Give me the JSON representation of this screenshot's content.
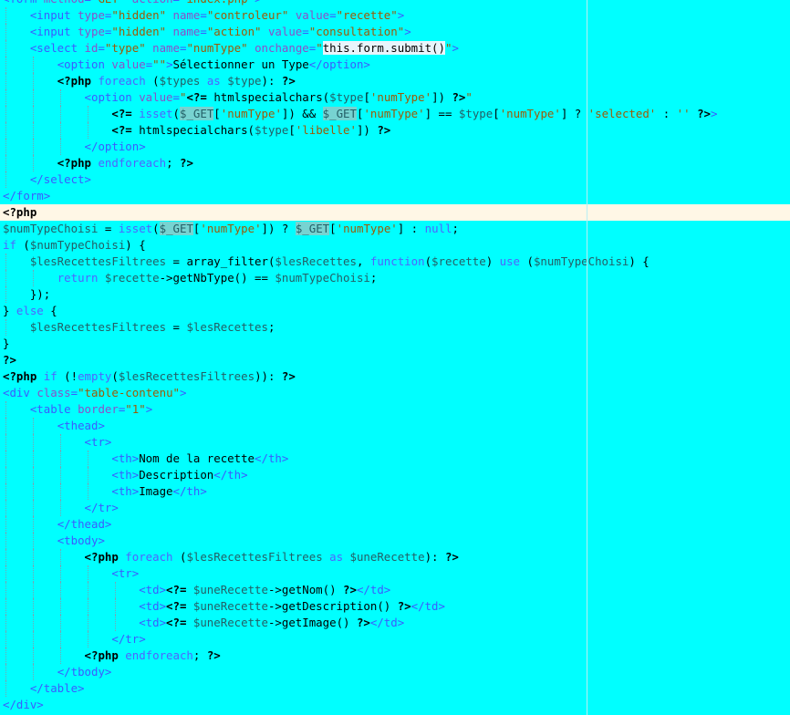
{
  "colors": {
    "background": "#00ffff",
    "current_line": "#fff7e6",
    "html_tag": "#3b5bff",
    "attribute": "#8a50c8",
    "string": "#9d5a05",
    "keyword": "#4f63ff",
    "variable": "#245f66"
  },
  "editor": {
    "lines": [
      {
        "indent": 0,
        "tokens": [
          [
            "tag",
            "<form "
          ],
          [
            "attr",
            "method"
          ],
          [
            "tag",
            "="
          ],
          [
            "str",
            "\"GET\" "
          ],
          [
            "attr",
            "action"
          ],
          [
            "tag",
            "="
          ],
          [
            "str",
            "\"index.php\""
          ],
          [
            "tag",
            ">"
          ]
        ]
      },
      {
        "indent": 1,
        "tokens": [
          [
            "tag",
            "<input "
          ],
          [
            "attr",
            "type"
          ],
          [
            "tag",
            "="
          ],
          [
            "str",
            "\"hidden\" "
          ],
          [
            "attr",
            "name"
          ],
          [
            "tag",
            "="
          ],
          [
            "str",
            "\"controleur\" "
          ],
          [
            "attr",
            "value"
          ],
          [
            "tag",
            "="
          ],
          [
            "str",
            "\"recette\""
          ],
          [
            "tag",
            ">"
          ]
        ]
      },
      {
        "indent": 1,
        "tokens": [
          [
            "tag",
            "<input "
          ],
          [
            "attr",
            "type"
          ],
          [
            "tag",
            "="
          ],
          [
            "str",
            "\"hidden\" "
          ],
          [
            "attr",
            "name"
          ],
          [
            "tag",
            "="
          ],
          [
            "str",
            "\"action\" "
          ],
          [
            "attr",
            "value"
          ],
          [
            "tag",
            "="
          ],
          [
            "str",
            "\"consultation\""
          ],
          [
            "tag",
            ">"
          ]
        ]
      },
      {
        "indent": 1,
        "tokens": [
          [
            "tag",
            "<select "
          ],
          [
            "attr",
            "id"
          ],
          [
            "tag",
            "="
          ],
          [
            "str",
            "\"type\" "
          ],
          [
            "attr",
            "name"
          ],
          [
            "tag",
            "="
          ],
          [
            "str",
            "\"numType\" "
          ],
          [
            "attr",
            "onchange"
          ],
          [
            "tag",
            "="
          ],
          [
            "str",
            "\""
          ],
          [
            "hl",
            "this.form.submit()"
          ],
          [
            "str",
            "\""
          ],
          [
            "tag",
            ">"
          ]
        ]
      },
      {
        "indent": 2,
        "tokens": [
          [
            "tag",
            "<option "
          ],
          [
            "attr",
            "value"
          ],
          [
            "tag",
            "="
          ],
          [
            "str",
            "\"\""
          ],
          [
            "tag",
            ">"
          ],
          [
            "txt",
            "Sélectionner un Type"
          ],
          [
            "tag",
            "</option>"
          ]
        ]
      },
      {
        "indent": 2,
        "tokens": [
          [
            "php",
            "<?php "
          ],
          [
            "kw",
            "foreach "
          ],
          [
            "op",
            "("
          ],
          [
            "var",
            "$types "
          ],
          [
            "kw",
            "as "
          ],
          [
            "var",
            "$type"
          ],
          [
            "op",
            "): "
          ],
          [
            "php",
            "?>"
          ]
        ]
      },
      {
        "indent": 3,
        "tokens": [
          [
            "tag",
            "<option "
          ],
          [
            "attr",
            "value"
          ],
          [
            "tag",
            "="
          ],
          [
            "str",
            "\""
          ],
          [
            "php",
            "<?= "
          ],
          [
            "fn",
            "htmlspecialchars("
          ],
          [
            "var",
            "$type"
          ],
          [
            "op",
            "["
          ],
          [
            "str",
            "'numType'"
          ],
          [
            "op",
            "]) "
          ],
          [
            "php",
            "?>"
          ],
          [
            "str",
            "\""
          ]
        ]
      },
      {
        "indent": 4,
        "tokens": [
          [
            "php",
            "<?= "
          ],
          [
            "kw",
            "isset"
          ],
          [
            "op",
            "("
          ],
          [
            "get",
            "$_GET"
          ],
          [
            "op",
            "["
          ],
          [
            "str",
            "'numType'"
          ],
          [
            "op",
            "]) && "
          ],
          [
            "get",
            "$_GET"
          ],
          [
            "op",
            "["
          ],
          [
            "str",
            "'numType'"
          ],
          [
            "op",
            "] == "
          ],
          [
            "var",
            "$type"
          ],
          [
            "op",
            "["
          ],
          [
            "str",
            "'numType'"
          ],
          [
            "op",
            "] ? "
          ],
          [
            "str",
            "'selected'"
          ],
          [
            "op",
            " : "
          ],
          [
            "str",
            "''"
          ],
          [
            "op",
            " "
          ],
          [
            "php",
            "?>"
          ],
          [
            "tag",
            ">"
          ]
        ]
      },
      {
        "indent": 4,
        "tokens": [
          [
            "php",
            "<?= "
          ],
          [
            "fn",
            "htmlspecialchars("
          ],
          [
            "var",
            "$type"
          ],
          [
            "op",
            "["
          ],
          [
            "str",
            "'libelle'"
          ],
          [
            "op",
            "]) "
          ],
          [
            "php",
            "?>"
          ]
        ]
      },
      {
        "indent": 3,
        "tokens": [
          [
            "tag",
            "</option>"
          ]
        ]
      },
      {
        "indent": 2,
        "tokens": [
          [
            "php",
            "<?php "
          ],
          [
            "kw",
            "endforeach"
          ],
          [
            "op",
            "; "
          ],
          [
            "php",
            "?>"
          ]
        ]
      },
      {
        "indent": 1,
        "tokens": [
          [
            "tag",
            "</select>"
          ]
        ]
      },
      {
        "indent": 0,
        "tokens": [
          [
            "tag",
            "</form>"
          ]
        ]
      },
      {
        "indent": 0,
        "current": true,
        "tokens": [
          [
            "php",
            "<?php"
          ]
        ]
      },
      {
        "indent": 0,
        "tokens": [
          [
            "var",
            "$numTypeChoisi"
          ],
          [
            "op",
            " = "
          ],
          [
            "kw",
            "isset"
          ],
          [
            "op",
            "("
          ],
          [
            "get",
            "$_GET"
          ],
          [
            "op",
            "["
          ],
          [
            "str",
            "'numType'"
          ],
          [
            "op",
            "]) ? "
          ],
          [
            "get",
            "$_GET"
          ],
          [
            "op",
            "["
          ],
          [
            "str",
            "'numType'"
          ],
          [
            "op",
            "] : "
          ],
          [
            "kw",
            "null"
          ],
          [
            "op",
            ";"
          ]
        ]
      },
      {
        "indent": 0,
        "tokens": [
          [
            "kw",
            "if "
          ],
          [
            "op",
            "("
          ],
          [
            "var",
            "$numTypeChoisi"
          ],
          [
            "op",
            ") {"
          ]
        ]
      },
      {
        "indent": 1,
        "tokens": [
          [
            "var",
            "$lesRecettesFiltrees"
          ],
          [
            "op",
            " = "
          ],
          [
            "fn",
            "array_filter("
          ],
          [
            "var",
            "$lesRecettes"
          ],
          [
            "op",
            ", "
          ],
          [
            "kw",
            "function"
          ],
          [
            "op",
            "("
          ],
          [
            "var",
            "$recette"
          ],
          [
            "op",
            ") "
          ],
          [
            "kw",
            "use "
          ],
          [
            "op",
            "("
          ],
          [
            "var",
            "$numTypeChoisi"
          ],
          [
            "op",
            ") {"
          ]
        ]
      },
      {
        "indent": 2,
        "tokens": [
          [
            "kw",
            "return "
          ],
          [
            "var",
            "$recette"
          ],
          [
            "op",
            "->"
          ],
          [
            "fn",
            "getNbType"
          ],
          [
            "op",
            "() == "
          ],
          [
            "var",
            "$numTypeChoisi"
          ],
          [
            "op",
            ";"
          ]
        ]
      },
      {
        "indent": 1,
        "tokens": [
          [
            "op",
            "});"
          ]
        ]
      },
      {
        "indent": 0,
        "tokens": [
          [
            "op",
            "} "
          ],
          [
            "kw",
            "else "
          ],
          [
            "op",
            "{"
          ]
        ]
      },
      {
        "indent": 1,
        "tokens": [
          [
            "var",
            "$lesRecettesFiltrees"
          ],
          [
            "op",
            " = "
          ],
          [
            "var",
            "$lesRecettes"
          ],
          [
            "op",
            ";"
          ]
        ]
      },
      {
        "indent": 0,
        "tokens": [
          [
            "op",
            "}"
          ]
        ]
      },
      {
        "indent": 0,
        "tokens": [
          [
            "php",
            "?>"
          ]
        ]
      },
      {
        "indent": 0,
        "tokens": [
          [
            "php",
            "<?php "
          ],
          [
            "kw",
            "if "
          ],
          [
            "op",
            "(!"
          ],
          [
            "kw",
            "empty"
          ],
          [
            "op",
            "("
          ],
          [
            "var",
            "$lesRecettesFiltrees"
          ],
          [
            "op",
            ")): "
          ],
          [
            "php",
            "?>"
          ]
        ]
      },
      {
        "indent": 0,
        "tokens": [
          [
            "tag",
            "<div "
          ],
          [
            "attr",
            "class"
          ],
          [
            "tag",
            "="
          ],
          [
            "str",
            "\"table-contenu\""
          ],
          [
            "tag",
            ">"
          ]
        ]
      },
      {
        "indent": 1,
        "tokens": [
          [
            "tag",
            "<table "
          ],
          [
            "attr",
            "border"
          ],
          [
            "tag",
            "="
          ],
          [
            "str",
            "\"1\""
          ],
          [
            "tag",
            ">"
          ]
        ]
      },
      {
        "indent": 2,
        "tokens": [
          [
            "tag",
            "<thead>"
          ]
        ]
      },
      {
        "indent": 3,
        "tokens": [
          [
            "tag",
            "<tr>"
          ]
        ]
      },
      {
        "indent": 4,
        "tokens": [
          [
            "tag",
            "<th>"
          ],
          [
            "txt",
            "Nom de la recette"
          ],
          [
            "tag",
            "</th>"
          ]
        ]
      },
      {
        "indent": 4,
        "tokens": [
          [
            "tag",
            "<th>"
          ],
          [
            "txt",
            "Description"
          ],
          [
            "tag",
            "</th>"
          ]
        ]
      },
      {
        "indent": 4,
        "tokens": [
          [
            "tag",
            "<th>"
          ],
          [
            "txt",
            "Image"
          ],
          [
            "tag",
            "</th>"
          ]
        ]
      },
      {
        "indent": 3,
        "tokens": [
          [
            "tag",
            "</tr>"
          ]
        ]
      },
      {
        "indent": 2,
        "tokens": [
          [
            "tag",
            "</thead>"
          ]
        ]
      },
      {
        "indent": 2,
        "tokens": [
          [
            "tag",
            "<tbody>"
          ]
        ]
      },
      {
        "indent": 3,
        "tokens": [
          [
            "php",
            "<?php "
          ],
          [
            "kw",
            "foreach "
          ],
          [
            "op",
            "("
          ],
          [
            "var",
            "$lesRecettesFiltrees "
          ],
          [
            "kw",
            "as "
          ],
          [
            "var",
            "$uneRecette"
          ],
          [
            "op",
            "): "
          ],
          [
            "php",
            "?>"
          ]
        ]
      },
      {
        "indent": 4,
        "tokens": [
          [
            "tag",
            "<tr>"
          ]
        ]
      },
      {
        "indent": 5,
        "tokens": [
          [
            "tag",
            "<td>"
          ],
          [
            "php",
            "<?= "
          ],
          [
            "var",
            "$uneRecette"
          ],
          [
            "op",
            "->"
          ],
          [
            "fn",
            "getNom"
          ],
          [
            "op",
            "() "
          ],
          [
            "php",
            "?>"
          ],
          [
            "tag",
            "</td>"
          ]
        ]
      },
      {
        "indent": 5,
        "tokens": [
          [
            "tag",
            "<td>"
          ],
          [
            "php",
            "<?= "
          ],
          [
            "var",
            "$uneRecette"
          ],
          [
            "op",
            "->"
          ],
          [
            "fn",
            "getDescription"
          ],
          [
            "op",
            "() "
          ],
          [
            "php",
            "?>"
          ],
          [
            "tag",
            "</td>"
          ]
        ]
      },
      {
        "indent": 5,
        "tokens": [
          [
            "tag",
            "<td>"
          ],
          [
            "php",
            "<?= "
          ],
          [
            "var",
            "$uneRecette"
          ],
          [
            "op",
            "->"
          ],
          [
            "fn",
            "getImage"
          ],
          [
            "op",
            "() "
          ],
          [
            "php",
            "?>"
          ],
          [
            "tag",
            "</td>"
          ]
        ]
      },
      {
        "indent": 4,
        "tokens": [
          [
            "tag",
            "</tr>"
          ]
        ]
      },
      {
        "indent": 3,
        "tokens": [
          [
            "php",
            "<?php "
          ],
          [
            "kw",
            "endforeach"
          ],
          [
            "op",
            "; "
          ],
          [
            "php",
            "?>"
          ]
        ]
      },
      {
        "indent": 2,
        "tokens": [
          [
            "tag",
            "</tbody>"
          ]
        ]
      },
      {
        "indent": 1,
        "tokens": [
          [
            "tag",
            "</table>"
          ]
        ]
      },
      {
        "indent": 0,
        "tokens": [
          [
            "tag",
            "</div>"
          ]
        ]
      }
    ]
  }
}
